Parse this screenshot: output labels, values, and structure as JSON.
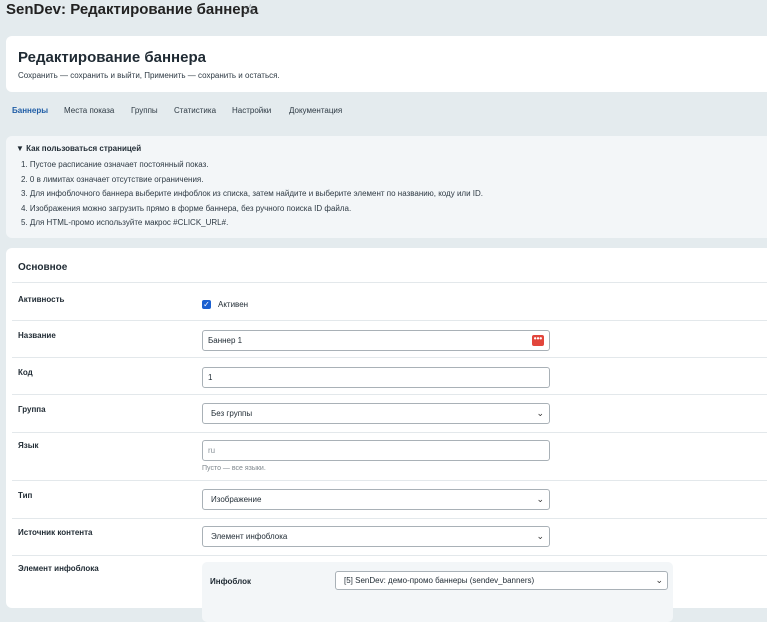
{
  "page": {
    "title": "SenDev: Редактирование баннера",
    "star_icon": "star-icon"
  },
  "header": {
    "title": "Редактирование баннера",
    "subtitle": "Сохранить — сохранить и выйти, Применить — сохранить и остаться."
  },
  "tabs": [
    {
      "label": "Баннеры",
      "active": true
    },
    {
      "label": "Места показа",
      "active": false
    },
    {
      "label": "Группы",
      "active": false
    },
    {
      "label": "Статистика",
      "active": false
    },
    {
      "label": "Настройки",
      "active": false
    },
    {
      "label": "Документация",
      "active": false
    }
  ],
  "help": {
    "summary": "▼ Как пользоваться страницей",
    "items": [
      "1. Пустое расписание означает постоянный показ.",
      "2. 0 в лимитах означает отсутствие ограничения.",
      "3. Для инфоблочного баннера выберите инфоблок из списка, затем найдите и выберите элемент по названию, коду или ID.",
      "4. Изображения можно загрузить прямо в форме баннера, без ручного поиска ID файла.",
      "5. Для HTML-промо используйте макрос #CLICK_URL#."
    ]
  },
  "form": {
    "section_title": "Основное",
    "active": {
      "label": "Активность",
      "checkbox_label": "Активен",
      "checked": true
    },
    "name": {
      "label": "Название",
      "value": "Баннер 1"
    },
    "code": {
      "label": "Код",
      "value": "1"
    },
    "group": {
      "label": "Группа",
      "value": "Без группы"
    },
    "language": {
      "label": "Язык",
      "value": "ru",
      "hint": "Пусто — все языки."
    },
    "type": {
      "label": "Тип",
      "value": "Изображение"
    },
    "source": {
      "label": "Источник контента",
      "value": "Элемент инфоблока"
    },
    "element": {
      "label": "Элемент инфоблока",
      "iblock_label": "Инфоблок",
      "iblock_value": "[5] SenDev: демо-промо баннеры (sendev_banners)"
    }
  },
  "colors": {
    "background": "#e4ebee",
    "active_tab": "#1f5da6",
    "checkbox": "#1a5fd0",
    "dots_button": "#e2463c"
  }
}
